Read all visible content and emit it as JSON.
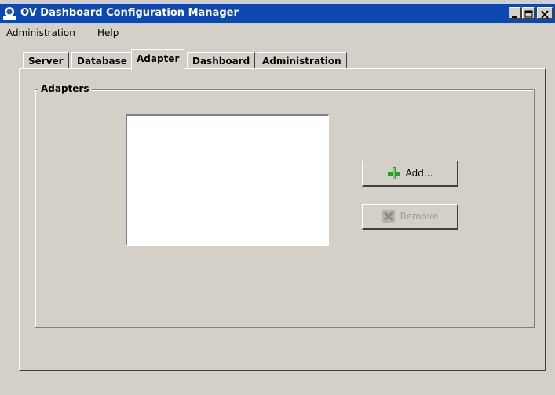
{
  "window": {
    "title": "OV Dashboard Configuration Manager"
  },
  "menu": {
    "items": [
      "Administration",
      "Help"
    ]
  },
  "tabs": [
    "Server",
    "Database",
    "Adapter",
    "Dashboard",
    "Administration"
  ],
  "active_tab": "Adapter",
  "adapters": {
    "group_label": "Adapters",
    "items": [],
    "add_label": "Add...",
    "remove_label": "Remove",
    "remove_enabled": false
  },
  "colors": {
    "titlebar": "#0d49b0",
    "face": "#d4d0c8",
    "add_icon": "#2a9d2a"
  },
  "icons": {
    "app": "app-logo-icon",
    "add": "plus-icon",
    "remove": "remove-x-icon"
  }
}
